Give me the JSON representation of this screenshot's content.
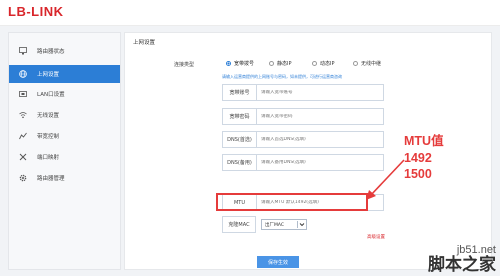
{
  "brand": {
    "logo_text": "LB-LINK"
  },
  "sidebar": {
    "items": [
      {
        "label": "路由器状态",
        "icon": "monitor-icon"
      },
      {
        "label": "上网设置",
        "icon": "globe-icon"
      },
      {
        "label": "LAN口设置",
        "icon": "lan-port-icon"
      },
      {
        "label": "无线设置",
        "icon": "wifi-icon"
      },
      {
        "label": "带宽控制",
        "icon": "bandwidth-icon"
      },
      {
        "label": "端口映射",
        "icon": "tools-icon"
      },
      {
        "label": "路由器管理",
        "icon": "gear-icon"
      }
    ],
    "active_index": 1
  },
  "main": {
    "title": "上网设置",
    "connection_type_label": "连接类型",
    "connection_options": [
      "宽带拨号",
      "静态IP",
      "动态IP",
      "无线中继"
    ],
    "selected_option_index": 0,
    "hint": "请输入运营商提供的上网账号与密码，如未提供，可进行运营商咨询",
    "fields": [
      {
        "label": "宽带账号",
        "placeholder": "请输入宽带账号"
      },
      {
        "label": "宽带密码",
        "placeholder": "请输入宽带密码"
      },
      {
        "label": "DNS(首选)",
        "placeholder": "请输入首选DNS(选填)"
      },
      {
        "label": "DNS(备用)",
        "placeholder": "请输入备用DNS(选填)"
      },
      {
        "label": "MTU",
        "placeholder": "请输入MTU 默认1492(选填)"
      }
    ],
    "mac": {
      "label": "克隆MAC",
      "value": "出厂MAC"
    },
    "advanced_link": "高级设置",
    "save_label": "保存生效"
  },
  "annotation": {
    "lines": [
      "MTU值",
      "1492",
      "1500"
    ],
    "color": "#e53b3b"
  },
  "watermark": {
    "domain": "jb51.net",
    "brand": "脚本之家"
  },
  "colors": {
    "accent": "#2c7ed6",
    "highlight": "#e53b3b",
    "logo": "#d9262b"
  }
}
